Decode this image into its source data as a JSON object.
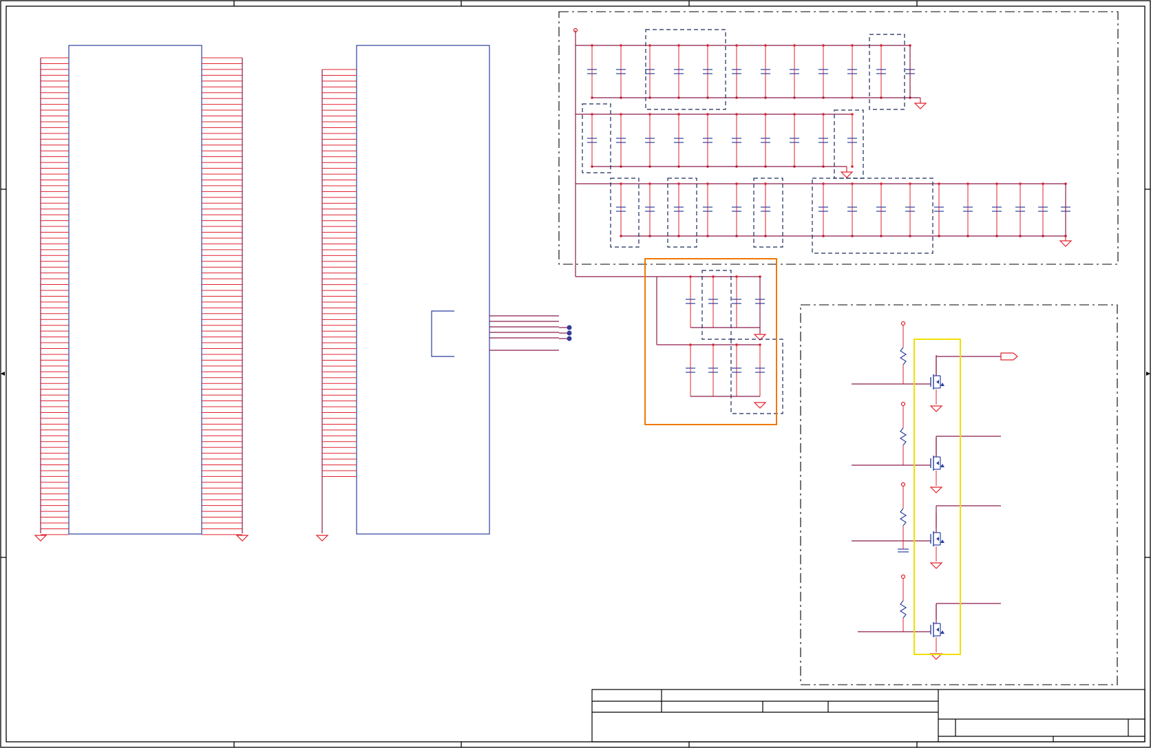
{
  "sheet": {
    "border_color": "#000000",
    "wire_color": "#8b1a4a",
    "pin_color": "#e0202c",
    "component_color": "#2a3f9e",
    "dashed_group_color": "#1a2a5a",
    "highlight_orange": "#f07800",
    "highlight_yellow": "#f0e000"
  },
  "connectors": {
    "left_pin_count": 83,
    "right_pin_count": 83,
    "center_pin_count": 71,
    "net_bus_lines": 6,
    "net_dots": 3
  },
  "capacitor_rows": {
    "row1_count": 12,
    "row2_count": 10,
    "row3_count": 16,
    "filter_top_count": 4,
    "filter_bottom_count": 4
  },
  "mosfet_stages": {
    "count": 4,
    "icons": [
      "resistor-icon",
      "nmos-icon",
      "ground-icon"
    ]
  },
  "title_block": {
    "cells": [
      "",
      "",
      "",
      "",
      "",
      "",
      "",
      ""
    ]
  }
}
